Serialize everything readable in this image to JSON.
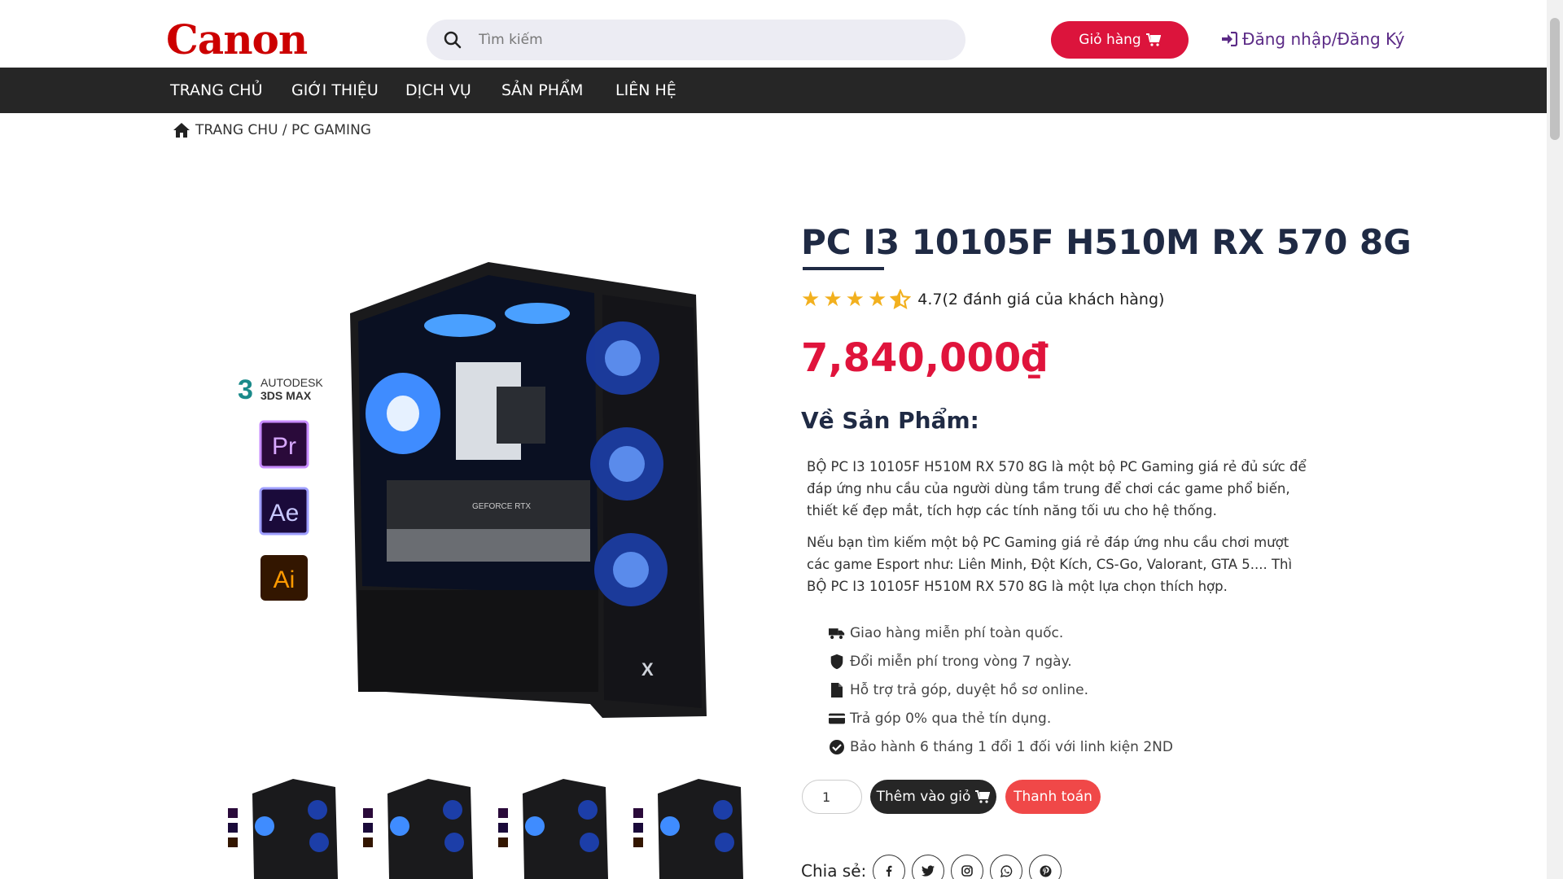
{
  "header": {
    "logo": "Canon",
    "search_placeholder": "Tìm kiếm",
    "cart_label": "Giỏ hàng",
    "login_label": "Đăng nhập/Đăng Ký"
  },
  "nav": {
    "items": [
      {
        "label": "TRANG CHỦ"
      },
      {
        "label": "GIỚI THIỆU"
      },
      {
        "label": "DỊCH VỤ"
      },
      {
        "label": "SẢN PHẨM"
      },
      {
        "label": "LIÊN HỆ"
      }
    ]
  },
  "breadcrumb": "TRANG CHU / PC GAMING",
  "product": {
    "title": "PC I3 10105F H510M RX 570 8G",
    "rating": 4.7,
    "rating_text": "4.7(2 đánh giá của khách hàng)",
    "price": "7,840,000₫",
    "about_title": "Về Sản Phẩm:",
    "description": [
      "BỘ PC I3 10105F H510M RX 570 8G là một bộ PC Gaming giá rẻ đủ sức để đáp ứng nhu cầu của người dùng tầm trung để chơi các game phổ biến, thiết kế đẹp mắt, tích hợp các tính năng tối ưu cho hệ thống.",
      "Nếu bạn tìm kiếm một bộ PC Gaming giá rẻ đáp ứng nhu cầu chơi mượt các game Esport như: Liên Minh, Đột Kích, CS-Go, Valorant, GTA 5.... Thì BỘ PC I3 10105F H510M RX 570 8G là một lựa chọn thích hợp."
    ],
    "features": [
      {
        "icon": "truck-icon",
        "text": "Giao hàng miễn phí toàn quốc."
      },
      {
        "icon": "shield-icon",
        "text": "Đổi miễn phí trong vòng 7 ngày."
      },
      {
        "icon": "file-icon",
        "text": "Hỗ trợ trả góp, duyệt hồ sơ online."
      },
      {
        "icon": "credit-card-icon",
        "text": "Trả góp 0% qua thẻ tín dụng."
      },
      {
        "icon": "check-circle-icon",
        "text": "Bảo hành 6 tháng 1 đổi 1 đối với linh kiện 2ND"
      }
    ],
    "quantity": "1",
    "add_to_cart_label": "Thêm vào giỏ",
    "checkout_label": "Thanh toán",
    "share_label": "Chia sẻ:",
    "share_icons": [
      "facebook-icon",
      "twitter-icon",
      "instagram-icon",
      "whatsapp-icon",
      "pinterest-icon"
    ],
    "image_badges": [
      "AUTODESK",
      "3DS MAX",
      "Pr",
      "Ae",
      "Ai"
    ],
    "gpu_label": "GEFORCE RTX"
  },
  "colors": {
    "accent": "#dc143c",
    "nav_bg": "#262626",
    "price": "#e0143c",
    "login": "#5b2a86",
    "star": "#f2b01e",
    "checkout": "#f04848"
  }
}
